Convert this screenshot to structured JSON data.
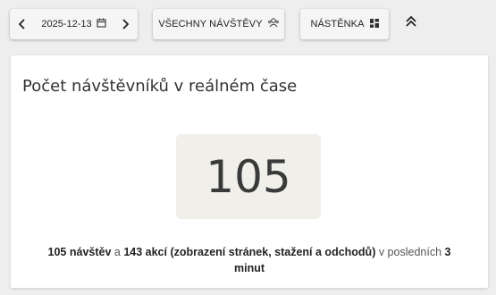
{
  "toolbar": {
    "date": "2025-12-13",
    "all_visits_label": "VŠECHNY NÁVŠTĚVY",
    "dashboard_label": "NÁSTĚNKA"
  },
  "card": {
    "title": "Počet návštěvníků v reálném čase",
    "counter": "105",
    "summary": {
      "visits": "105 návštěv",
      "conj": " a ",
      "actions": "143 akcí (zobrazení stránek, stažení a odchodů)",
      "middle": " v posledních ",
      "minutes_num": "3",
      "minutes_unit": "minut"
    }
  },
  "icons": {
    "prev": "chevron-left-icon",
    "calendar": "calendar-icon",
    "next": "chevron-right-icon",
    "visitors": "visitors-icon",
    "dashboard": "dashboard-grid-icon",
    "collapse": "double-chevron-up-icon"
  },
  "colors": {
    "background": "#eeeeee",
    "button": "#f5f5f5",
    "card": "#ffffff",
    "counter_box": "#f0efea"
  }
}
